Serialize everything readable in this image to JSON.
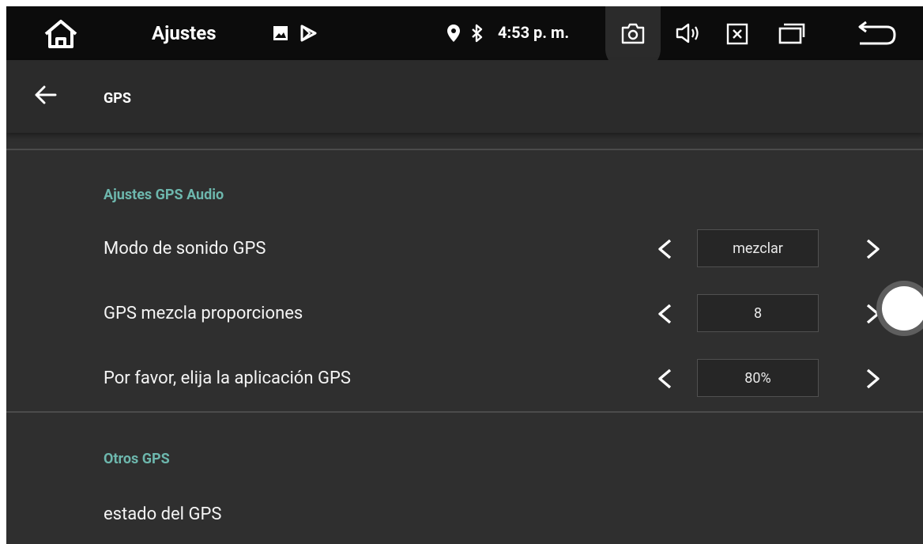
{
  "status_bar": {
    "title": "Ajustes",
    "time": "4:53 p. m.",
    "icons": [
      "home-icon",
      "image-icon",
      "play-store-icon",
      "location-icon",
      "bluetooth-icon",
      "screenshot-icon",
      "volume-icon",
      "close-box-icon",
      "recent-apps-icon",
      "back-return-icon"
    ]
  },
  "app_bar": {
    "title": "GPS",
    "back_icon": "back-arrow-icon"
  },
  "sections": {
    "audio_title": "Ajustes GPS Audio",
    "rows": [
      {
        "label": "Modo de sonido GPS",
        "value": "mezclar"
      },
      {
        "label": "GPS mezcla proporciones",
        "value": "8"
      },
      {
        "label": "Por favor, elija la aplicación GPS",
        "value": "80%"
      }
    ],
    "other_title": "Otros GPS",
    "other_rows": [
      {
        "label": "estado del GPS"
      }
    ]
  },
  "colors": {
    "accent": "#6db7ad",
    "background": "#2f2f2f",
    "status_bar": "#0c0c0c"
  }
}
